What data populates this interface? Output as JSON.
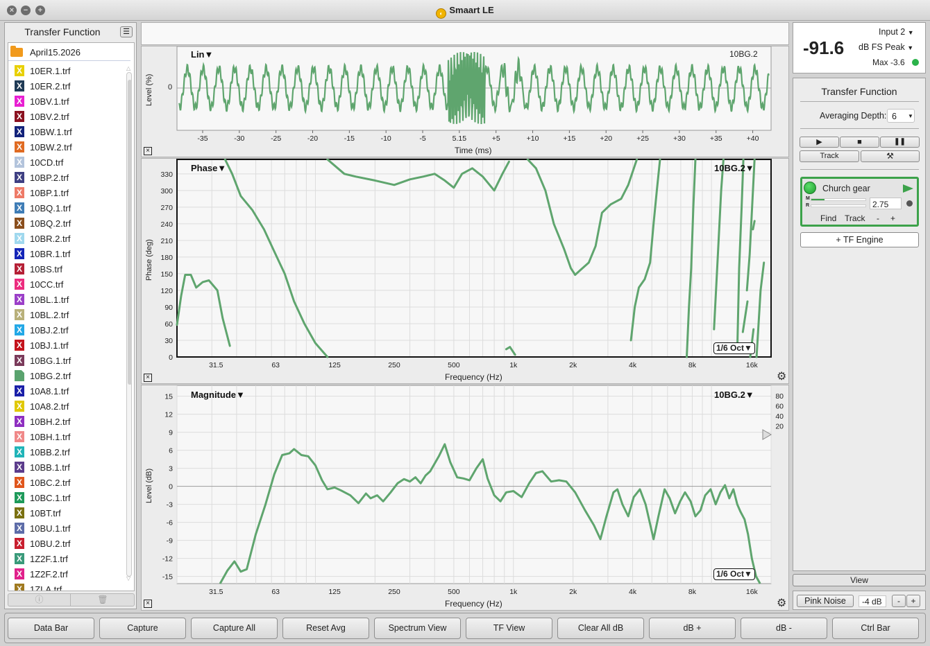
{
  "window": {
    "title": "Smaart LE"
  },
  "left_panel": {
    "title": "Transfer Function",
    "folder": "April15.2026",
    "files": [
      {
        "name": "10ER.1.trf",
        "color": "#e8d000"
      },
      {
        "name": "10ER.2.trf",
        "color": "#1f3a55"
      },
      {
        "name": "10BV.1.trf",
        "color": "#e81fd2"
      },
      {
        "name": "10BV.2.trf",
        "color": "#8b1120"
      },
      {
        "name": "10BW.1.trf",
        "color": "#12227a"
      },
      {
        "name": "10BW.2.trf",
        "color": "#e06b22"
      },
      {
        "name": "10CD.trf",
        "color": "#b3c4dc"
      },
      {
        "name": "10BP.2.trf",
        "color": "#3e3f82"
      },
      {
        "name": "10BP.1.trf",
        "color": "#ee7a67"
      },
      {
        "name": "10BQ.1.trf",
        "color": "#3f7db6"
      },
      {
        "name": "10BQ.2.trf",
        "color": "#8a4e1c"
      },
      {
        "name": "10BR.2.trf",
        "color": "#9fd8ee"
      },
      {
        "name": "10BR.1.trf",
        "color": "#1425b8"
      },
      {
        "name": "10BS.trf",
        "color": "#b52036"
      },
      {
        "name": "10CC.trf",
        "color": "#ec2c7e"
      },
      {
        "name": "10BL.1.trf",
        "color": "#9b3fc8"
      },
      {
        "name": "10BL.2.trf",
        "color": "#b8b07a"
      },
      {
        "name": "10BJ.2.trf",
        "color": "#23a8e6"
      },
      {
        "name": "10BJ.1.trf",
        "color": "#c4131c"
      },
      {
        "name": "10BG.1.trf",
        "color": "#7a3a5a"
      },
      {
        "name": "10BG.2.trf",
        "color": "#5aa36e",
        "doc": true
      },
      {
        "name": "10A8.1.trf",
        "color": "#1a1fa8"
      },
      {
        "name": "10A8.2.trf",
        "color": "#e0c800"
      },
      {
        "name": "10BH.2.trf",
        "color": "#8e2ec0"
      },
      {
        "name": "10BH.1.trf",
        "color": "#f08888"
      },
      {
        "name": "10BB.2.trf",
        "color": "#20b4b8"
      },
      {
        "name": "10BB.1.trf",
        "color": "#5c3c8c"
      },
      {
        "name": "10BC.2.trf",
        "color": "#e0561c"
      },
      {
        "name": "10BC.1.trf",
        "color": "#1e9a5a"
      },
      {
        "name": "10BT.trf",
        "color": "#7a7010"
      },
      {
        "name": "10BU.1.trf",
        "color": "#5d6ca8"
      },
      {
        "name": "10BU.2.trf",
        "color": "#c81e2e"
      },
      {
        "name": "1Z2F.1.trf",
        "color": "#3a9a7a"
      },
      {
        "name": "1Z2F.2.trf",
        "color": "#e0208a"
      },
      {
        "name": "1ZLA.trf",
        "color": "#a07a20"
      }
    ]
  },
  "time_plot": {
    "mode_label": "Lin▼",
    "trace_label": "10BG.2",
    "ylabel": "Level (%)",
    "ytick": "0",
    "xlabel": "Time (ms)",
    "xticks": [
      "-35",
      "-30",
      "-25",
      "-20",
      "-15",
      "-10",
      "-5",
      "5.15",
      "+5",
      "+10",
      "+15",
      "+20",
      "+25",
      "+30",
      "+35",
      "+40"
    ]
  },
  "phase_plot": {
    "mode_label": "Phase▼",
    "trace_label": "10BG.2▼",
    "ylabel": "Phase (deg)",
    "yticks": [
      "330",
      "300",
      "270",
      "240",
      "210",
      "180",
      "150",
      "120",
      "90",
      "60",
      "30",
      "0"
    ],
    "xlabel": "Frequency (Hz)",
    "xticks": [
      "31.5",
      "63",
      "125",
      "250",
      "500",
      "1k",
      "2k",
      "4k",
      "8k",
      "16k"
    ],
    "smoothing": "1/6 Oct▼"
  },
  "mag_plot": {
    "mode_label": "Magnitude▼",
    "trace_label": "10BG.2▼",
    "ylabel": "Level (dB)",
    "yticks": [
      "15",
      "12",
      "9",
      "6",
      "3",
      "0",
      "-3",
      "-6",
      "-9",
      "-12",
      "-15"
    ],
    "right_ticks": [
      "80",
      "60",
      "40",
      "20"
    ],
    "xlabel": "Frequency (Hz)",
    "xticks": [
      "31.5",
      "63",
      "125",
      "250",
      "500",
      "1k",
      "2k",
      "4k",
      "8k",
      "16k"
    ],
    "smoothing": "1/6 Oct▼"
  },
  "meter": {
    "input": "Input 2",
    "value": "-91.6",
    "mode": "dB FS Peak",
    "max": "Max -3.6",
    "status_color": "#2bb34a"
  },
  "tf_panel": {
    "title": "Transfer Function",
    "averaging_label": "Averaging Depth:",
    "averaging_value": "6",
    "track_label": "Track",
    "engine": {
      "name": "Church gear",
      "delay": "2.75",
      "m_level": 0.24,
      "find_label": "Find",
      "track_label": "Track",
      "minus": "-",
      "plus": "+"
    },
    "add_engine": "+ TF Engine",
    "view_label": "View",
    "pink_noise": "Pink Noise",
    "noise_level": "-4 dB",
    "nl_minus": "-",
    "nl_plus": "+"
  },
  "bottom_bar": [
    "Data Bar",
    "Capture",
    "Capture All",
    "Reset Avg",
    "Spectrum View",
    "TF View",
    "Clear All dB",
    "dB +",
    "dB -",
    "Ctrl Bar"
  ],
  "colors": {
    "trace": "#5fa56e",
    "grid": "#dcdcdc",
    "zero": "#9a9a9a"
  }
}
